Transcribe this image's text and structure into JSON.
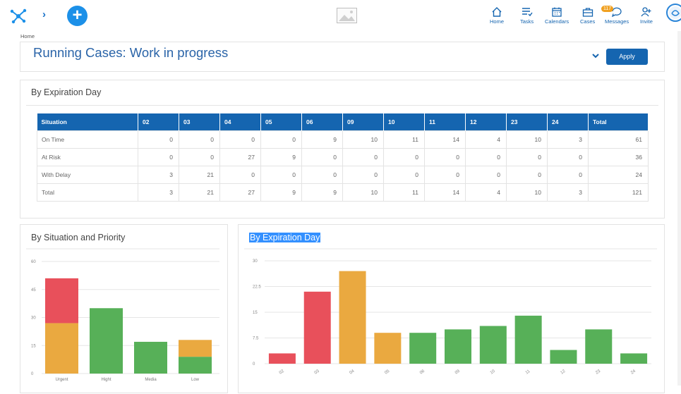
{
  "breadcrumb": "Home",
  "header": {
    "title": "Running Cases: Work in progress",
    "apply_label": "Apply"
  },
  "nav": {
    "home": "Home",
    "tasks": "Tasks",
    "calendars": "Calendars",
    "cases": "Cases",
    "messages": "Messages",
    "messages_count": "117",
    "invite": "Invite"
  },
  "table_card": {
    "title": "By Expiration Day",
    "columns": [
      "Situation",
      "02",
      "03",
      "04",
      "05",
      "06",
      "09",
      "10",
      "11",
      "12",
      "23",
      "24",
      "Total"
    ],
    "rows": [
      [
        "On Time",
        "0",
        "0",
        "0",
        "0",
        "9",
        "10",
        "11",
        "14",
        "4",
        "10",
        "3",
        "61"
      ],
      [
        "At Risk",
        "0",
        "0",
        "27",
        "9",
        "0",
        "0",
        "0",
        "0",
        "0",
        "0",
        "0",
        "36"
      ],
      [
        "With Delay",
        "3",
        "21",
        "0",
        "0",
        "0",
        "0",
        "0",
        "0",
        "0",
        "0",
        "0",
        "24"
      ],
      [
        "Total",
        "3",
        "21",
        "27",
        "9",
        "9",
        "10",
        "11",
        "14",
        "4",
        "10",
        "3",
        "121"
      ]
    ]
  },
  "colors": {
    "red": "#e8505b",
    "orange": "#eaa940",
    "green": "#57b058",
    "blue": "#1565b0"
  },
  "chart_data": [
    {
      "type": "bar",
      "title": "By Situation and Priority",
      "stacked": true,
      "categories": [
        "Urgent",
        "Hight",
        "Media",
        "Low"
      ],
      "series": [
        {
          "color": "#57b058",
          "values": [
            0,
            35,
            17,
            9
          ]
        },
        {
          "color": "#eaa940",
          "values": [
            27,
            0,
            0,
            9
          ]
        },
        {
          "color": "#e8505b",
          "values": [
            24,
            0,
            0,
            0
          ]
        }
      ],
      "ylim": [
        0,
        60
      ],
      "yticks": [
        "0",
        "15",
        "30",
        "45",
        "60"
      ],
      "grid": true
    },
    {
      "type": "bar",
      "title": "By Expiration Day",
      "categories": [
        "02",
        "03",
        "04",
        "05",
        "06",
        "09",
        "10",
        "11",
        "12",
        "23",
        "24"
      ],
      "values": [
        3,
        21,
        27,
        9,
        9,
        10,
        11,
        14,
        4,
        10,
        3
      ],
      "bar_colors": [
        "#e8505b",
        "#e8505b",
        "#eaa940",
        "#eaa940",
        "#57b058",
        "#57b058",
        "#57b058",
        "#57b058",
        "#57b058",
        "#57b058",
        "#57b058"
      ],
      "ylim": [
        0,
        30
      ],
      "yticks": [
        "0",
        "7.5",
        "15",
        "22.5",
        "30"
      ],
      "grid": true
    }
  ]
}
